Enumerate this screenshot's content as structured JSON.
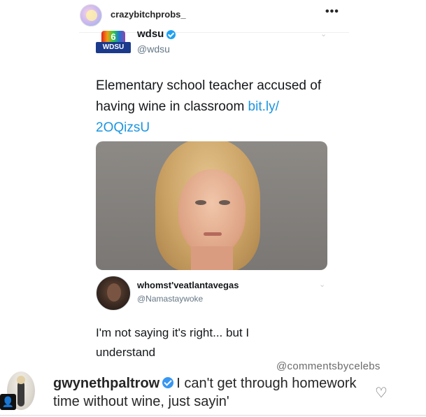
{
  "post": {
    "username": "crazybitchprobs_",
    "more_icon": "more-horizontal-icon",
    "more_glyph": "•••"
  },
  "tweet1": {
    "avatar_top": "6",
    "avatar_bottom": "WDSU",
    "name": "wdsu",
    "handle": "@wdsu",
    "text_plain": "Elementary school teacher accused of having wine in classroom ",
    "link": "bit.ly/ 2OQizsU",
    "chevron": "⌄"
  },
  "tweet2": {
    "name": "whomst'veatlantavegas",
    "handle": "@Namastaywoke",
    "text": "I'm not saying it's right... but I understand",
    "chevron": "⌄"
  },
  "watermark": "@commentsbycelebs",
  "comment": {
    "username": "gwynethpaltrow",
    "text": "I can't get through homework time without wine, just sayin'",
    "like_icon": "heart-outline-icon",
    "like_glyph": "♡",
    "badge_glyph": "👤"
  },
  "colors": {
    "link": "#1b95e0",
    "verified_twitter": "#1da1f2",
    "verified_instagram": "#3897f0"
  }
}
